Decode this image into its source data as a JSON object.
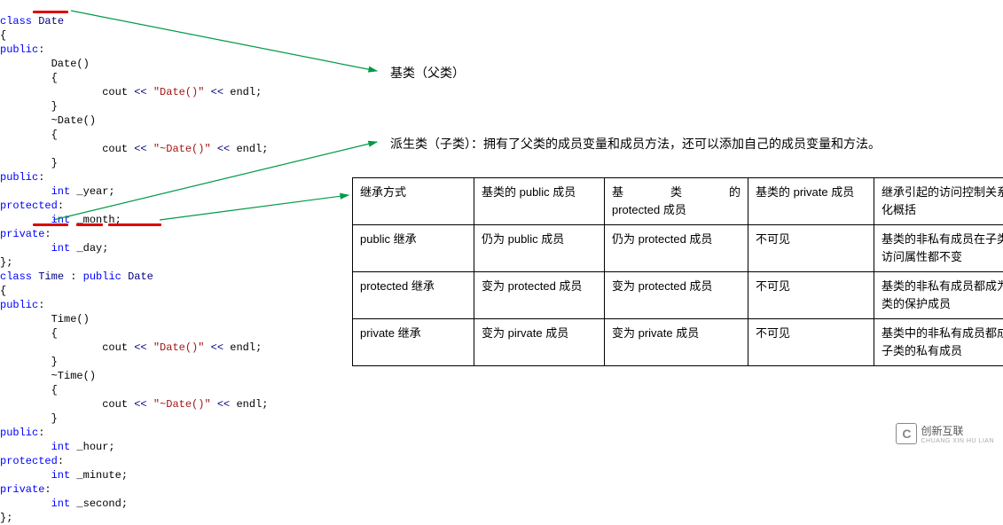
{
  "code": {
    "l1a": "class",
    "l1b": "Date",
    "l1c": "",
    "l2": "{",
    "l3a": "public",
    "l3b": ":",
    "l4": "        Date()",
    "l5": "        {",
    "l6a": "                cout ",
    "l6b": "<<",
    "l6c": " \"Date()\" ",
    "l6d": "<<",
    "l6e": " endl;",
    "l7": "        }",
    "l8": "        ~Date()",
    "l9": "        {",
    "l10a": "                cout ",
    "l10b": "<<",
    "l10c": " \"~Date()\" ",
    "l10d": "<<",
    "l10e": " endl;",
    "l11": "        }",
    "l12a": "public",
    "l12b": ":",
    "l13a": "        int",
    "l13b": " _year;",
    "l14a": "protected",
    "l14b": ":",
    "l15a": "        int",
    "l15b": " _month;",
    "l16a": "private",
    "l16b": ":",
    "l17a": "        int",
    "l17b": " _day;",
    "l18": "};",
    "l19a": "class",
    "l19b": "Time",
    "l19c": ":",
    "l19d": "public",
    "l19e": "Date",
    "l20": "{",
    "l21a": "public",
    "l21b": ":",
    "l22": "        Time()",
    "l23": "        {",
    "l24a": "                cout ",
    "l24b": "<<",
    "l24c": " \"Date()\" ",
    "l24d": "<<",
    "l24e": " endl;",
    "l25": "        }",
    "l26": "        ~Time()",
    "l27": "        {",
    "l28a": "                cout ",
    "l28b": "<<",
    "l28c": " \"~Date()\" ",
    "l28d": "<<",
    "l28e": " endl;",
    "l29": "        }",
    "l30a": "public",
    "l30b": ":",
    "l31a": "        int",
    "l31b": " _hour;",
    "l32a": "protected",
    "l32b": ":",
    "l33a": "        int",
    "l33b": " _minute;",
    "l34a": "private",
    "l34b": ":",
    "l35a": "        int",
    "l35b": " _second;",
    "l36": "};"
  },
  "labels": {
    "base": "基类（父类）",
    "derived": "派生类（子类）：拥有了父类的成员变量和成员方法，还可以添加自己的成员变量和方法。"
  },
  "table": {
    "h1": "继承方式",
    "h2": "基类的 public 成员",
    "h3a": "基",
    "h3b": "类",
    "h3c": "的",
    "h3d": "protected 成员",
    "h4": "基类的 private 成员",
    "h5": "继承引起的访问控制关系变化概括",
    "r1c1": "public 继承",
    "r1c2": "仍为 public 成员",
    "r1c3": "仍为 protected 成员",
    "r1c4": "不可见",
    "r1c5": "基类的非私有成员在子类的访问属性都不变",
    "r2c1": "protected 继承",
    "r2c2": "变为 protected 成员",
    "r2c3": "变为 protected 成员",
    "r2c4": "不可见",
    "r2c5": "基类的非私有成员都成为子类的保护成员",
    "r3c1": "private 继承",
    "r3c2": "变为 pirvate 成员",
    "r3c3": "变为 private 成员",
    "r3c4": "不可见",
    "r3c5": "基类中的非私有成员都成为子类的私有成员"
  },
  "watermark": {
    "brand": "创新互联",
    "sub": "CHUANG XIN HU LIAN",
    "logo": "C"
  }
}
